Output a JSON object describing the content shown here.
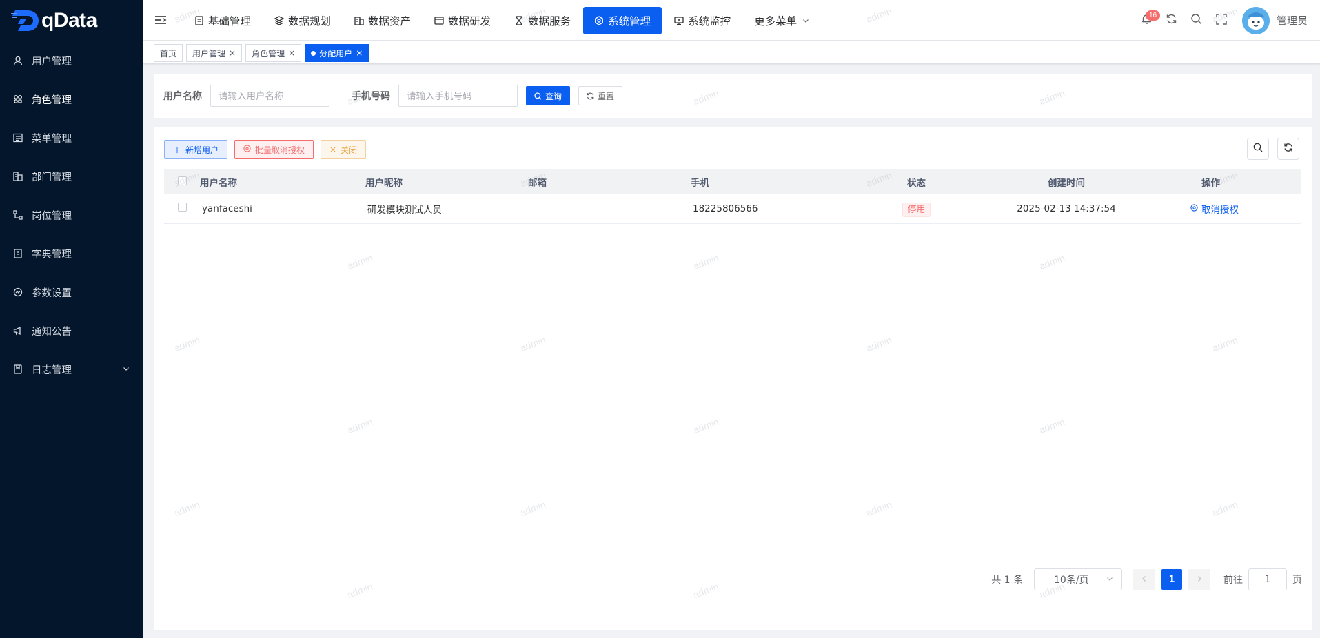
{
  "app": {
    "logo_text": "qData"
  },
  "sidebar": {
    "items": [
      {
        "label": "用户管理",
        "icon": "user-icon"
      },
      {
        "label": "角色管理",
        "icon": "role-icon"
      },
      {
        "label": "菜单管理",
        "icon": "menu-list-icon"
      },
      {
        "label": "部门管理",
        "icon": "department-icon"
      },
      {
        "label": "岗位管理",
        "icon": "post-icon"
      },
      {
        "label": "字典管理",
        "icon": "dictionary-icon"
      },
      {
        "label": "参数设置",
        "icon": "settings-icon"
      },
      {
        "label": "通知公告",
        "icon": "megaphone-icon"
      },
      {
        "label": "日志管理",
        "icon": "log-icon"
      }
    ]
  },
  "topnav": {
    "items": [
      {
        "label": "基础管理"
      },
      {
        "label": "数据规划"
      },
      {
        "label": "数据资产"
      },
      {
        "label": "数据研发"
      },
      {
        "label": "数据服务"
      },
      {
        "label": "系统管理"
      },
      {
        "label": "系统监控"
      },
      {
        "label": "更多菜单"
      }
    ],
    "notification_count": "16",
    "user_name": "管理员"
  },
  "tags": {
    "items": [
      {
        "label": "首页"
      },
      {
        "label": "用户管理"
      },
      {
        "label": "角色管理"
      },
      {
        "label": "分配用户"
      }
    ]
  },
  "search": {
    "username_label": "用户名称",
    "username_placeholder": "请输入用户名称",
    "phone_label": "手机号码",
    "phone_placeholder": "请输入手机号码",
    "query_label": "查询",
    "reset_label": "重置"
  },
  "toolbar": {
    "add_label": "新增用户",
    "batch_cancel_label": "批量取消授权",
    "close_label": "关闭"
  },
  "table": {
    "headers": [
      "用户名称",
      "用户昵称",
      "邮箱",
      "手机",
      "状态",
      "创建时间",
      "操作"
    ],
    "rows": [
      {
        "username": "yanfaceshi",
        "nickname": "研发模块测试人员",
        "email": "",
        "phone": "18225806566",
        "status": "停用",
        "created": "2025-02-13 14:37:54",
        "action": "取消授权"
      }
    ]
  },
  "pagination": {
    "total": "共 1 条",
    "page_size": "10条/页",
    "current_page": "1",
    "goto_label": "前往",
    "goto_value": "1",
    "page_suffix": "页"
  },
  "watermark": "admin",
  "colors": {
    "primary": "#0a5ef0",
    "sidebar_bg": "#04162b",
    "danger": "#f56c6c",
    "warning": "#e6a23c"
  }
}
